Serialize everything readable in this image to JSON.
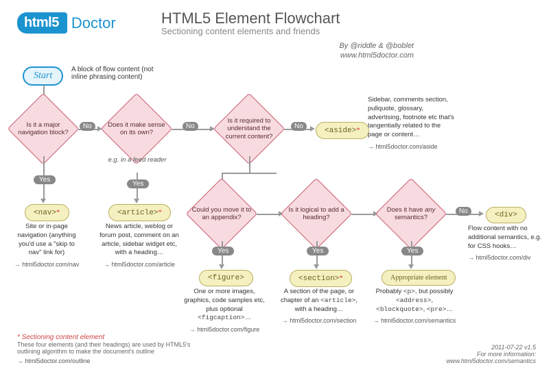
{
  "header": {
    "logo_badge": "html5",
    "logo_doc": "Doctor",
    "title": "HTML5 Element Flowchart",
    "subtitle": "Sectioning content elements and friends",
    "byline1": "By @riddle & @boblet",
    "byline2": "www.html5doctor.com"
  },
  "start": {
    "label": "Start",
    "desc": "A block of flow content (not inline phrasing content)"
  },
  "q": {
    "nav": "Is it a major navigation block?",
    "own": "Does it make sense on its own?",
    "own_hint": "e.g. in a feed reader",
    "required": "Is it required to understand the current content?",
    "appendix": "Could you move it to an appendix?",
    "heading": "Is it logical to add a heading?",
    "semantics_a": "Does it have ",
    "semantics_b": "any",
    "semantics_c": " semantics?"
  },
  "yn": {
    "yes": "Yes",
    "no": "No"
  },
  "res": {
    "nav": {
      "tag": "<nav>",
      "desc": "Site or in-page navigation (anything you'd use a \"skip to nav\" link for)",
      "link": "html5doctor.com/nav"
    },
    "article": {
      "tag": "<article>",
      "desc": "News article, weblog or forum post, comment on an article, sidebar widget etc, with a heading…",
      "link": "html5doctor.com/article"
    },
    "aside": {
      "tag": "<aside>",
      "desc": "Sidebar, comments section, pullquote, glossary, advertising, footnote etc that's tangentially related to the page or content…",
      "link": "html5doctor.com/aside"
    },
    "figure": {
      "tag": "<figure>",
      "desc_a": "One or more images, graphics, code samples etc, plus optional ",
      "desc_b": "<figcaption>",
      "desc_c": "…",
      "link": "html5doctor.com/figure"
    },
    "section": {
      "tag": "<section>",
      "desc_a": "A section of the page, or chapter of an ",
      "desc_b": "<article>",
      "desc_c": ", with a heading…",
      "link": "html5doctor.com/section"
    },
    "appropriate": {
      "tag": "Appropriate element",
      "desc_a": "Probably ",
      "desc_b": "<p>",
      "desc_c": ", but possibly ",
      "desc_d": "<address>",
      "desc_e": ", ",
      "desc_f": "<blockquote>",
      "desc_g": ", ",
      "desc_h": "<pre>",
      "desc_i": "…",
      "link": "html5doctor.com/semantics"
    },
    "div": {
      "tag": "<div>",
      "desc": "Flow content with no additional semantics, e.g. for CSS hooks…",
      "link": "html5doctor.com/div"
    }
  },
  "footer": {
    "left_title": "* Sectioning content element",
    "left_body": "These four elements (and their headings) are used by HTML5's outlining algorithm to make the document's outline",
    "left_link": "html5doctor.com/outline",
    "right1": "2011-07-22 v1.5",
    "right2": "For more information:",
    "right3": "www.html5doctor.com/semantics"
  },
  "chart_data": {
    "type": "flowchart",
    "start": {
      "id": "start",
      "label": "Start",
      "note": "A block of flow content (not inline phrasing content)"
    },
    "decisions": [
      {
        "id": "nav_q",
        "text": "Is it a major navigation block?",
        "yes": "nav",
        "no": "own_q"
      },
      {
        "id": "own_q",
        "text": "Does it make sense on its own? (e.g. in a feed reader)",
        "yes": "article",
        "no": "required_q"
      },
      {
        "id": "required_q",
        "text": "Is it required to understand the current content?",
        "yes": "appendix_q",
        "no": "aside"
      },
      {
        "id": "appendix_q",
        "text": "Could you move it to an appendix?",
        "yes": "figure",
        "no": "heading_q"
      },
      {
        "id": "heading_q",
        "text": "Is it logical to add a heading?",
        "yes": "section",
        "no": "semantics_q"
      },
      {
        "id": "semantics_q",
        "text": "Does it have any semantics?",
        "yes": "appropriate",
        "no": "div"
      }
    ],
    "results": [
      {
        "id": "nav",
        "element": "<nav>",
        "sectioning": true,
        "desc": "Site or in-page navigation (anything you'd use a \"skip to nav\" link for)",
        "link": "html5doctor.com/nav"
      },
      {
        "id": "article",
        "element": "<article>",
        "sectioning": true,
        "desc": "News article, weblog or forum post, comment on an article, sidebar widget etc, with a heading…",
        "link": "html5doctor.com/article"
      },
      {
        "id": "aside",
        "element": "<aside>",
        "sectioning": true,
        "desc": "Sidebar, comments section, pullquote, glossary, advertising, footnote etc that's tangentially related to the page or content…",
        "link": "html5doctor.com/aside"
      },
      {
        "id": "figure",
        "element": "<figure>",
        "sectioning": false,
        "desc": "One or more images, graphics, code samples etc, plus optional <figcaption>…",
        "link": "html5doctor.com/figure"
      },
      {
        "id": "section",
        "element": "<section>",
        "sectioning": true,
        "desc": "A section of the page, or chapter of an <article>, with a heading…",
        "link": "html5doctor.com/section"
      },
      {
        "id": "appropriate",
        "element": "Appropriate element",
        "sectioning": false,
        "desc": "Probably <p>, but possibly <address>, <blockquote>, <pre>…",
        "link": "html5doctor.com/semantics"
      },
      {
        "id": "div",
        "element": "<div>",
        "sectioning": false,
        "desc": "Flow content with no additional semantics, e.g. for CSS hooks…",
        "link": "html5doctor.com/div"
      }
    ]
  }
}
